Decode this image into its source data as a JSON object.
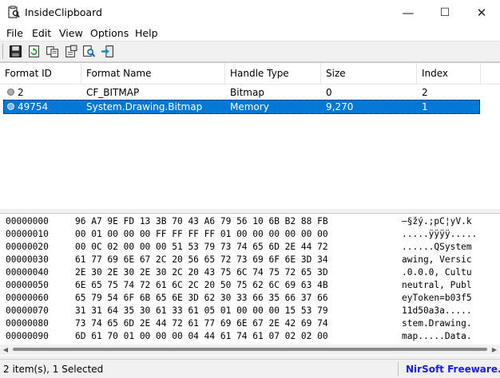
{
  "window": {
    "title": "InsideClipboard",
    "minimize": "—",
    "maximize": "☐",
    "close": "✕"
  },
  "menu": [
    "File",
    "Edit",
    "View",
    "Options",
    "Help"
  ],
  "table": {
    "columns": [
      "Format ID",
      "Format Name",
      "Handle Type",
      "Size",
      "Index"
    ],
    "rows": [
      {
        "id": "2",
        "name": "CF_BITMAP",
        "handle": "Bitmap",
        "size": "0",
        "index": "2",
        "selected": false
      },
      {
        "id": "49754",
        "name": "System.Drawing.Bitmap",
        "handle": "Memory",
        "size": "9,270",
        "index": "1",
        "selected": true
      }
    ]
  },
  "hex": [
    {
      "offset": "00000000",
      "bytes": "96 A7 9E FD 13 3B 70 43 A6 79 56 10 6B B2 88 FB",
      "ascii": "–§žý.;pC¦yV.k"
    },
    {
      "offset": "00000010",
      "bytes": "00 01 00 00 00 FF FF FF FF 01 00 00 00 00 00 00",
      "ascii": ".....ÿÿÿÿ....."
    },
    {
      "offset": "00000020",
      "bytes": "00 0C 02 00 00 00 51 53 79 73 74 65 6D 2E 44 72",
      "ascii": "......QSystem"
    },
    {
      "offset": "00000030",
      "bytes": "61 77 69 6E 67 2C 20 56 65 72 73 69 6F 6E 3D 34",
      "ascii": "awing, Versic"
    },
    {
      "offset": "00000040",
      "bytes": "2E 30 2E 30 2E 30 2C 20 43 75 6C 74 75 72 65 3D",
      "ascii": ".0.0.0, Cultu"
    },
    {
      "offset": "00000050",
      "bytes": "6E 65 75 74 72 61 6C 2C 20 50 75 62 6C 69 63 4B",
      "ascii": "neutral, Publ"
    },
    {
      "offset": "00000060",
      "bytes": "65 79 54 6F 6B 65 6E 3D 62 30 33 66 35 66 37 66",
      "ascii": "eyToken=b03f5"
    },
    {
      "offset": "00000070",
      "bytes": "31 31 64 35 30 61 33 61 05 01 00 00 00 15 53 79",
      "ascii": "11d50a3a....."
    },
    {
      "offset": "00000080",
      "bytes": "73 74 65 6D 2E 44 72 61 77 69 6E 67 2E 42 69 74",
      "ascii": "stem.Drawing."
    },
    {
      "offset": "00000090",
      "bytes": "6D 61 70 01 00 00 00 04 44 61 74 61 07 02 02 00",
      "ascii": "map.....Data."
    }
  ],
  "status": {
    "items": "2 item(s), 1 Selected",
    "link": "NirSoft Freeware. htt"
  },
  "colors": {
    "selection": "#0078d7",
    "link": "#1a1aff"
  },
  "toolbar_icons": [
    "save-icon",
    "refresh-icon",
    "copy-icon",
    "properties-icon",
    "find-icon",
    "exit-icon"
  ]
}
